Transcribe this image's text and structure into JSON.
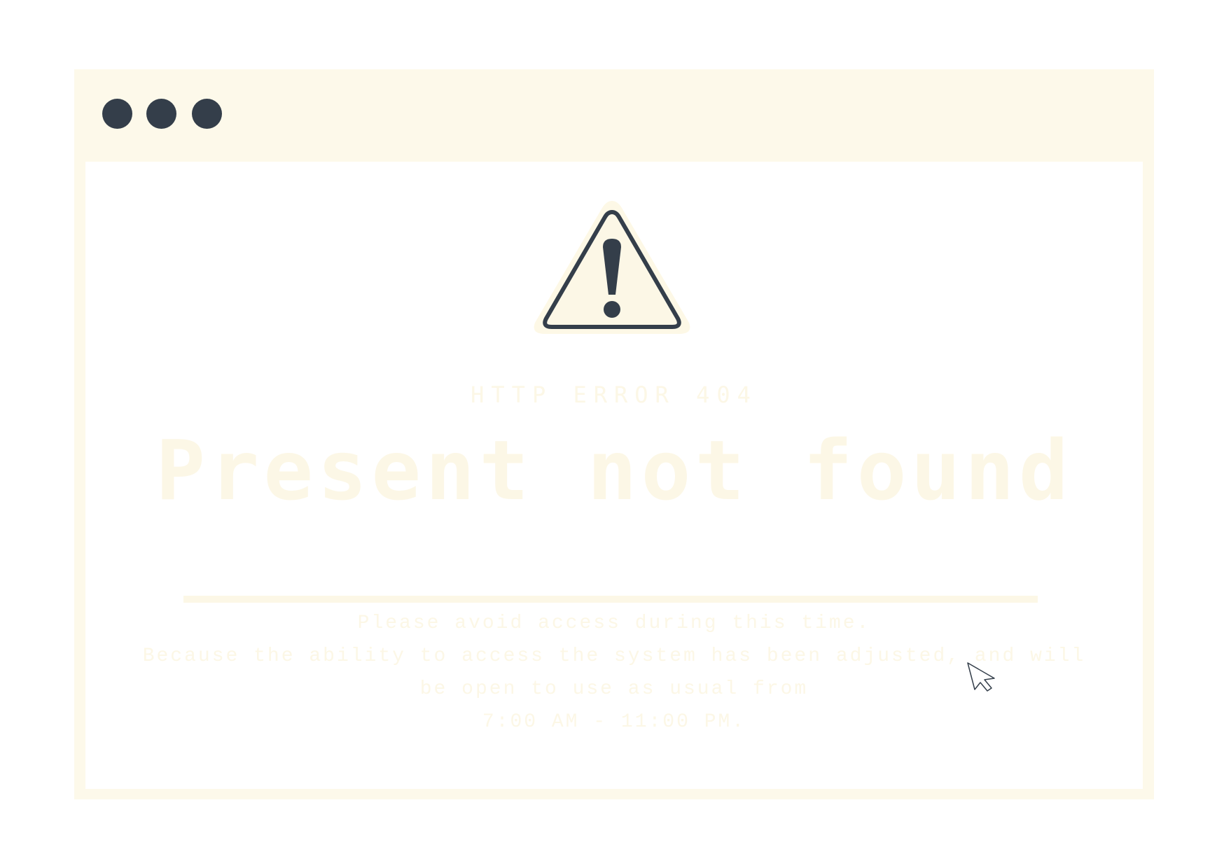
{
  "window": {
    "dots": [
      "window-dot",
      "window-dot",
      "window-dot"
    ],
    "colors": {
      "frame": "#fdf9ea",
      "dot": "#343e4a",
      "text": "#fcf7e6"
    }
  },
  "error": {
    "icon": "warning-triangle-icon",
    "code": "HTTP ERROR 404",
    "title": "Present not found",
    "message_lines": [
      "Please avoid access during this time.",
      "Because the ability to access the system has been adjusted, and will",
      "be open to use as usual from",
      "7:00 AM - 11:00 PM."
    ]
  },
  "cursor": {
    "icon": "mouse-pointer-icon"
  }
}
